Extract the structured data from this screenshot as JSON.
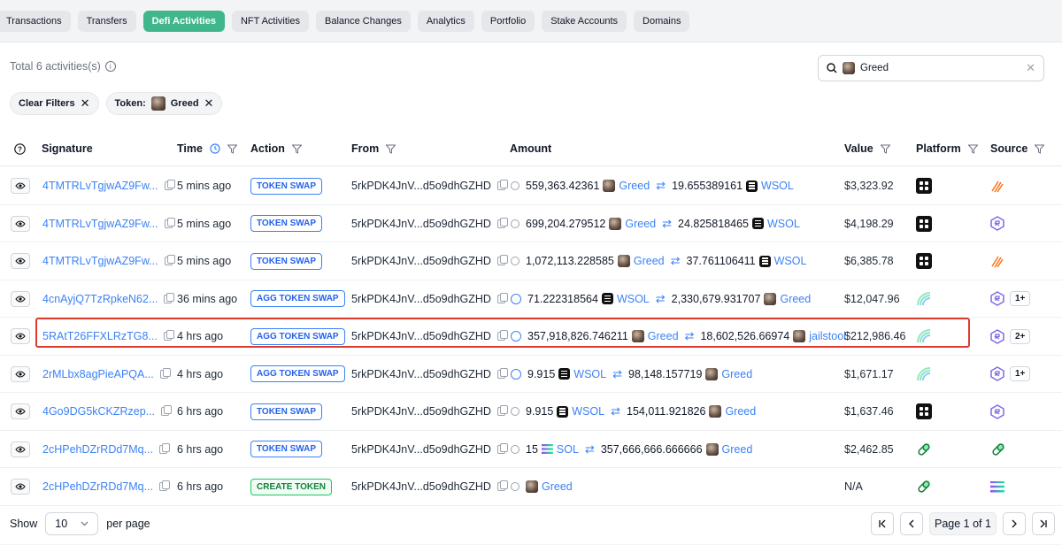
{
  "tabs": [
    "Transactions",
    "Transfers",
    "Defi Activities",
    "NFT Activities",
    "Balance Changes",
    "Analytics",
    "Portfolio",
    "Stake Accounts",
    "Domains"
  ],
  "active_tab": "Defi Activities",
  "summary": {
    "total": "Total 6 activities(s)"
  },
  "search": {
    "value": "Greed"
  },
  "filters": {
    "clear": "Clear Filters",
    "token_label": "Token:",
    "token_value": "Greed"
  },
  "columns": {
    "signature": "Signature",
    "time": "Time",
    "action": "Action",
    "from": "From",
    "amount": "Amount",
    "value": "Value",
    "platform": "Platform",
    "source": "Source"
  },
  "rows": [
    {
      "sig": "4TMTRLvTgjwAZ9Fw...",
      "time": "5 mins ago",
      "action": "TOKEN SWAP",
      "from": "5rkPDK4JnV...d5o9dhGZHD",
      "a1": "559,363.42361",
      "t1": "Greed",
      "a2": "19.655389161",
      "t2": "WSOL",
      "value": "$3,323.92",
      "more": ""
    },
    {
      "sig": "4TMTRLvTgjwAZ9Fw...",
      "time": "5 mins ago",
      "action": "TOKEN SWAP",
      "from": "5rkPDK4JnV...d5o9dhGZHD",
      "a1": "699,204.279512",
      "t1": "Greed",
      "a2": "24.825818465",
      "t2": "WSOL",
      "value": "$4,198.29",
      "more": ""
    },
    {
      "sig": "4TMTRLvTgjwAZ9Fw...",
      "time": "5 mins ago",
      "action": "TOKEN SWAP",
      "from": "5rkPDK4JnV...d5o9dhGZHD",
      "a1": "1,072,113.228585",
      "t1": "Greed",
      "a2": "37.761106411",
      "t2": "WSOL",
      "value": "$6,385.78",
      "more": ""
    },
    {
      "sig": "4cnAyjQ7TzRpkeN62...",
      "time": "36 mins ago",
      "action": "AGG TOKEN SWAP",
      "from": "5rkPDK4JnV...d5o9dhGZHD",
      "a1": "71.222318564",
      "t1": "WSOL",
      "a2": "2,330,679.931707",
      "t2": "Greed",
      "value": "$12,047.96",
      "more": "1+"
    },
    {
      "sig": "5RAtT26FFXLRzTG8...",
      "time": "4 hrs ago",
      "action": "AGG TOKEN SWAP",
      "from": "5rkPDK4JnV...d5o9dhGZHD",
      "a1": "357,918,826.746211",
      "t1": "Greed",
      "a2": "18,602,526.66974",
      "t2": "jailstool",
      "value": "$212,986.46",
      "more": "2+"
    },
    {
      "sig": "2rMLbx8agPieAPQA...",
      "time": "4 hrs ago",
      "action": "AGG TOKEN SWAP",
      "from": "5rkPDK4JnV...d5o9dhGZHD",
      "a1": "9.915",
      "t1": "WSOL",
      "a2": "98,148.157719",
      "t2": "Greed",
      "value": "$1,671.17",
      "more": "1+"
    },
    {
      "sig": "4Go9DG5kCKZRzep...",
      "time": "6 hrs ago",
      "action": "TOKEN SWAP",
      "from": "5rkPDK4JnV...d5o9dhGZHD",
      "a1": "9.915",
      "t1": "WSOL",
      "a2": "154,011.921826",
      "t2": "Greed",
      "value": "$1,637.46",
      "more": ""
    },
    {
      "sig": "2cHPehDZrRDd7Mq...",
      "time": "6 hrs ago",
      "action": "TOKEN SWAP",
      "from": "5rkPDK4JnV...d5o9dhGZHD",
      "a1": "15",
      "t1": "SOL",
      "a2": "357,666,666.666666",
      "t2": "Greed",
      "value": "$2,462.85",
      "more": ""
    },
    {
      "sig": "2cHPehDZrRDd7Mq...",
      "time": "6 hrs ago",
      "action": "CREATE TOKEN",
      "from": "5rkPDK4JnV...d5o9dhGZHD",
      "a1": "",
      "t1": "Greed",
      "a2": "",
      "t2": "",
      "value": "N/A",
      "more": ""
    }
  ],
  "footer": {
    "show": "Show",
    "per_page_value": "10",
    "per_page": "per page",
    "page_text": "Page 1 of 1"
  },
  "icons": {
    "platforms": [
      "black-grid-icon",
      "black-grid-icon",
      "black-grid-icon",
      "rainbow-arc-icon",
      "rainbow-arc-icon",
      "rainbow-arc-icon",
      "black-grid-icon",
      "pill-icon",
      "pill-icon"
    ],
    "sources": [
      "orange-stripes-icon",
      "raydium-icon",
      "orange-stripes-icon",
      "raydium-icon",
      "raydium-icon",
      "raydium-icon",
      "raydium-icon",
      "pill-icon",
      "solana-icon"
    ]
  },
  "colors": {
    "accent": "#3fb68b",
    "link": "#3b82f6",
    "highlight": "#dc3b2e"
  }
}
